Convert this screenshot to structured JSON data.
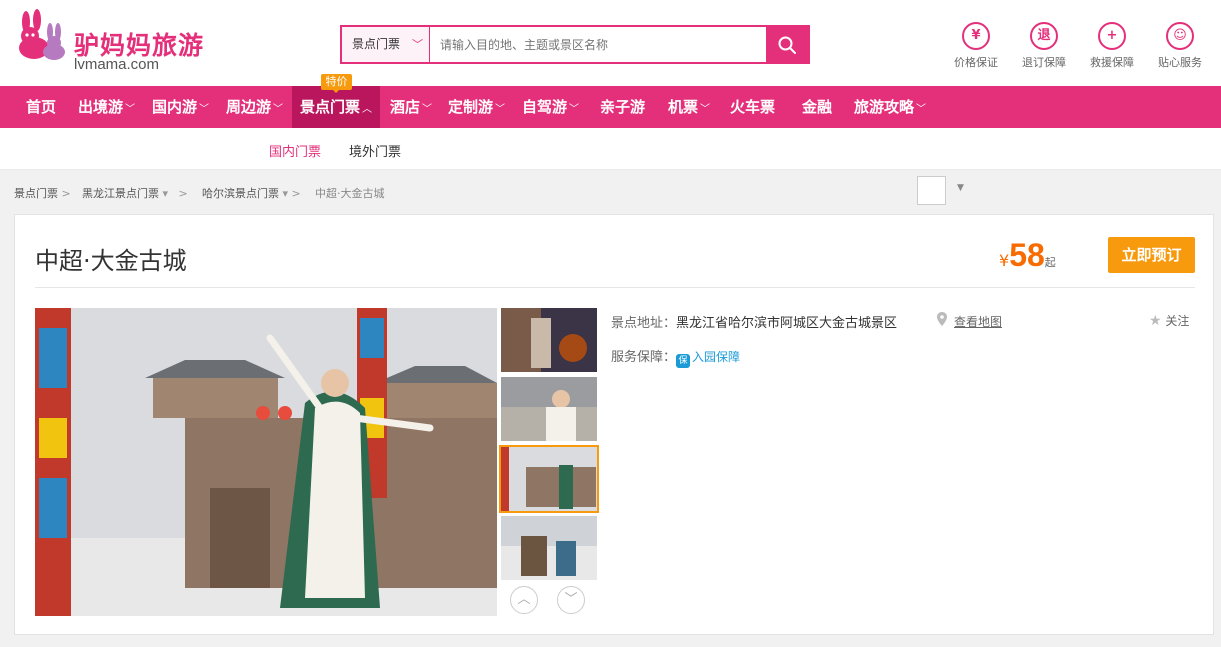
{
  "header": {
    "logo_text": "驴妈妈旅游",
    "logo_domain": "lvmama.com",
    "search": {
      "category": "景点门票",
      "placeholder": "请输入目的地、主题或景区名称"
    },
    "services": [
      {
        "label": "价格保证",
        "glyph": "¥",
        "icon": "price-guarantee-icon"
      },
      {
        "label": "退订保障",
        "glyph": "退",
        "icon": "refund-guarantee-icon"
      },
      {
        "label": "救援保障",
        "glyph": "+",
        "icon": "rescue-guarantee-icon"
      },
      {
        "label": "贴心服务",
        "glyph": "☺",
        "icon": "service-icon"
      }
    ]
  },
  "nav": {
    "items": [
      "首页",
      "出境游",
      "国内游",
      "周边游",
      "景点门票",
      "酒店",
      "定制游",
      "自驾游",
      "亲子游",
      "机票",
      "火车票",
      "金融",
      "旅游攻略"
    ],
    "active": "景点门票",
    "promo_badge": "特价",
    "sub_items": [
      "国内门票",
      "境外门票"
    ]
  },
  "breadcrumb": [
    "景点门票",
    "黑龙江景点门票",
    "哈尔滨景点门票",
    "中超·大金古城"
  ],
  "product": {
    "title": "中超·大金古城",
    "price_symbol": "¥",
    "price": "58",
    "price_suffix": "起",
    "book_label": "立即预订",
    "address_label": "景点地址：",
    "address": "黑龙江省哈尔滨市阿城区大金古城景区",
    "map_link": "查看地图",
    "service_label": "服务保障：",
    "service_badge": "保",
    "service_value": "入园保障",
    "follow_label": "关注"
  },
  "colors": {
    "brand": "#e4307a",
    "brand_dark": "#b9165d",
    "accent": "#f79a0e",
    "price": "#f76b00"
  }
}
